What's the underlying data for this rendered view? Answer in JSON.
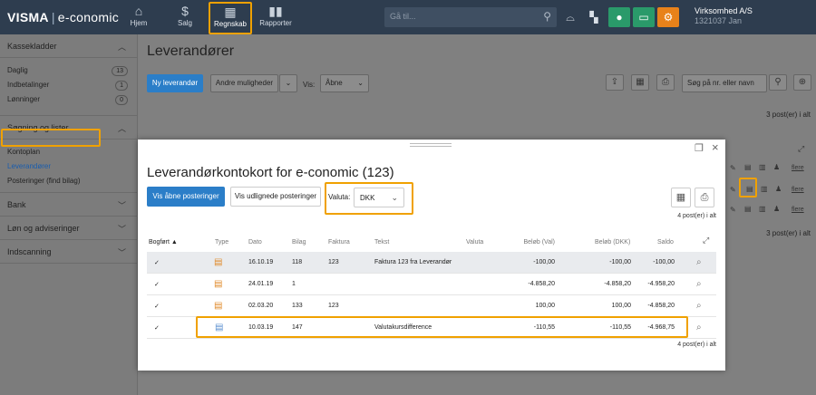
{
  "topbar": {
    "brand": "VISMA",
    "brand_sep": "|",
    "brand_product": "e-conomic",
    "nav": [
      {
        "label": "Hjem",
        "icon": "home-icon"
      },
      {
        "label": "Salg",
        "icon": "dollar-icon"
      },
      {
        "label": "Regnskab",
        "icon": "calculator-icon"
      },
      {
        "label": "Rapporter",
        "icon": "bar-chart-icon"
      }
    ],
    "search_placeholder": "Gå til...",
    "company_name": "Virksomhed A/S",
    "company_id": "1321037 Jan",
    "accent_green": "#2a9a6a",
    "accent_orange": "#e8821a"
  },
  "sidebar": {
    "sections": [
      {
        "label": "Kassekladder",
        "items": [
          {
            "label": "Daglig",
            "count": "13"
          },
          {
            "label": "Indbetalinger",
            "count": "1"
          },
          {
            "label": "Lønninger",
            "count": "0"
          }
        ]
      },
      {
        "label": "Søgning og lister",
        "items": [
          {
            "label": "Kontoplan"
          },
          {
            "label": "Leverandører"
          },
          {
            "label": "Posteringer (find bilag)"
          }
        ]
      },
      {
        "label": "Bank"
      },
      {
        "label": "Løn og adviseringer"
      },
      {
        "label": "Indscanning"
      }
    ]
  },
  "main": {
    "title": "Leverandører",
    "new_button": "Ny leverandør",
    "other_options": "Andre muligheder",
    "vis_label": "Vis:",
    "vis_value": "Åbne",
    "search_placeholder": "Søg på nr. eller navn",
    "count_top": "3 post(er) i alt",
    "count_bottom": "3 post(er) i alt",
    "more_label": "flere"
  },
  "modal": {
    "title": "Leverandørkontokort for e-conomic (123)",
    "btn_open": "Vis åbne posteringer",
    "btn_settle": "Vis udlignede posteringer",
    "valuta_label": "Valuta:",
    "valuta_value": "DKK",
    "count_top": "4 post(er) i alt",
    "count_bottom": "4 post(er) i alt",
    "columns": {
      "bogfort": "Bogført ▲",
      "type": "Type",
      "dato": "Dato",
      "bilag": "Bilag",
      "faktura": "Faktura",
      "tekst": "Tekst",
      "valuta": "Valuta",
      "belob_val": "Beløb (Val)",
      "belob_dkk": "Beløb (DKK)",
      "saldo": "Saldo"
    },
    "rows": [
      {
        "check": "✓",
        "dato": "16.10.19",
        "bilag": "118",
        "faktura": "123",
        "tekst": "Faktura 123 fra Leverandør",
        "valuta": "",
        "belob_val": "-100,00",
        "belob_dkk": "-100,00",
        "saldo": "-100,00"
      },
      {
        "check": "✓",
        "dato": "24.01.19",
        "bilag": "1",
        "faktura": "",
        "tekst": "",
        "valuta": "",
        "belob_val": "-4.858,20",
        "belob_dkk": "-4.858,20",
        "saldo": "-4.958,20"
      },
      {
        "check": "✓",
        "dato": "02.03.20",
        "bilag": "133",
        "faktura": "123",
        "tekst": "",
        "valuta": "",
        "belob_val": "100,00",
        "belob_dkk": "100,00",
        "saldo": "-4.858,20"
      },
      {
        "check": "✓",
        "dato": "10.03.19",
        "bilag": "147",
        "faktura": "",
        "tekst": "Valutakursdifference",
        "valuta": "",
        "belob_val": "-110,55",
        "belob_dkk": "-110,55",
        "saldo": "-4.968,75"
      }
    ]
  }
}
